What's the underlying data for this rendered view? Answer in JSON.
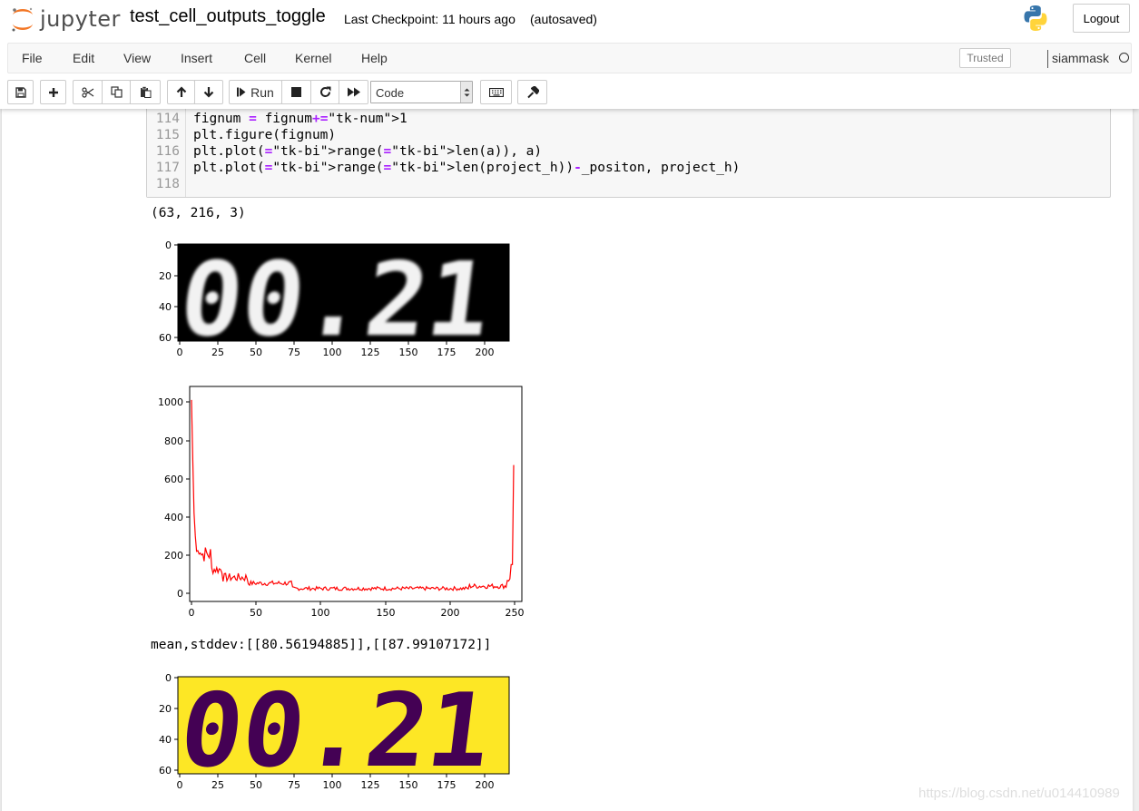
{
  "header": {
    "logo_text": "jupyter",
    "notebook_name": "test_cell_outputs_toggle",
    "checkpoint": "Last Checkpoint: 11 hours ago",
    "autosave_status": "(autosaved)",
    "logout_label": "Logout"
  },
  "menubar": {
    "items": [
      "File",
      "Edit",
      "View",
      "Insert",
      "Cell",
      "Kernel",
      "Help"
    ],
    "trusted_label": "Trusted",
    "kernel_name": "siammask"
  },
  "toolbar": {
    "run_label": "Run",
    "cell_type": "Code",
    "icons": [
      "save-icon",
      "plus-icon",
      "cut-icon",
      "copy-icon",
      "paste-icon",
      "arrow-up-icon",
      "arrow-down-icon",
      "step-forward-icon",
      "stop-icon",
      "restart-icon",
      "fast-forward-icon",
      "keyboard-icon",
      "wrench-icon"
    ]
  },
  "code_cell": {
    "line_numbers": [
      "114",
      "115",
      "116",
      "117",
      "118"
    ],
    "lines": [
      "fignum = fignum+1",
      "plt.figure(fignum)",
      "plt.plot(range(len(a)), a)",
      "plt.plot(range(len(project_h))-_positon, project_h)",
      ""
    ]
  },
  "outputs": {
    "shape_text": "(63, 216, 3)",
    "mean_std_text": "mean,stddev:[[80.56194885]],[[87.99107172]]"
  },
  "plot1": {
    "y_ticks": [
      "0",
      "20",
      "40",
      "60"
    ],
    "x_ticks": [
      "0",
      "25",
      "50",
      "75",
      "100",
      "125",
      "150",
      "175",
      "200"
    ],
    "digits": "00.21"
  },
  "plot2": {
    "y_ticks": [
      "0",
      "200",
      "400",
      "600",
      "800",
      "1000"
    ],
    "x_ticks": [
      "0",
      "50",
      "100",
      "150",
      "200",
      "250"
    ],
    "line_color": "#ff0000"
  },
  "plot3": {
    "y_ticks": [
      "0",
      "20",
      "40",
      "60"
    ],
    "x_ticks": [
      "0",
      "25",
      "50",
      "75",
      "100",
      "125",
      "150",
      "175",
      "200"
    ],
    "digits": "00.21",
    "bg_color": "#fde725",
    "fg_color": "#440154"
  },
  "watermark": "https://blog.csdn.net/u014410989",
  "colors": {
    "accent_orange": "#f37726",
    "page_bg": "#eeeeee"
  }
}
